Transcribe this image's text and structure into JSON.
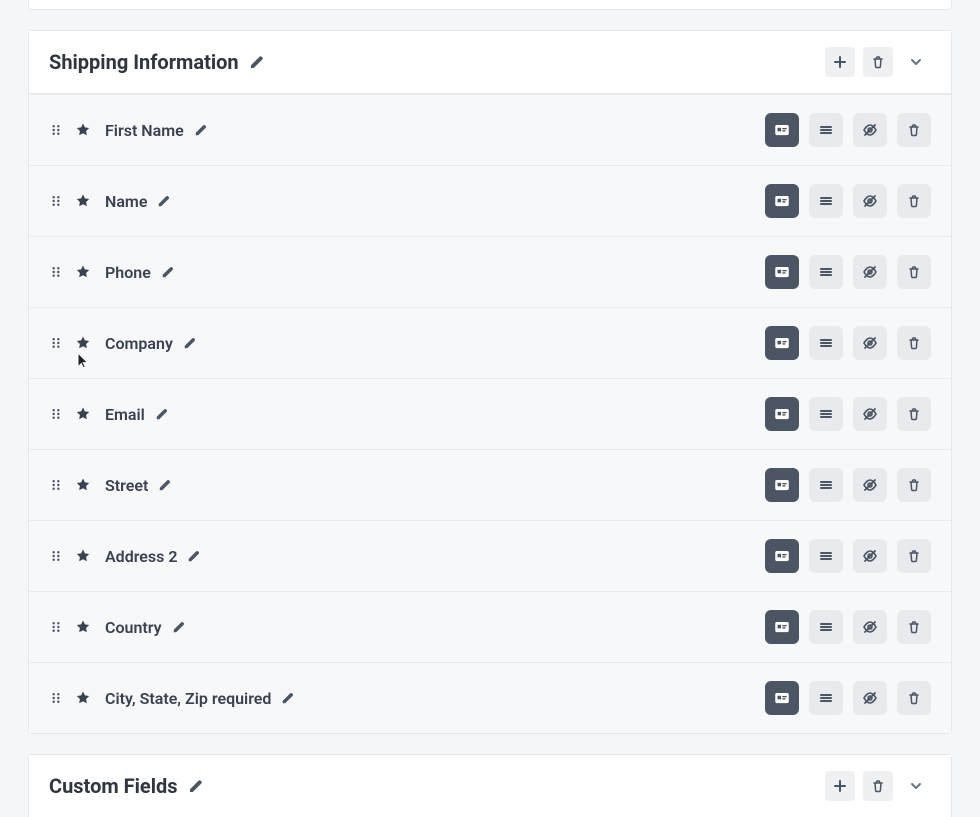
{
  "sections": [
    {
      "title": "Shipping Information",
      "fields": [
        {
          "label": "First Name"
        },
        {
          "label": "Name"
        },
        {
          "label": "Phone"
        },
        {
          "label": "Company"
        },
        {
          "label": "Email"
        },
        {
          "label": "Street"
        },
        {
          "label": "Address 2"
        },
        {
          "label": "Country"
        },
        {
          "label": "City, State, Zip required"
        }
      ]
    },
    {
      "title": "Custom Fields",
      "fields": []
    }
  ],
  "colors": {
    "page_bg": "#f4f6f8",
    "panel_bg": "#ffffff",
    "row_bg": "#f7f8fa",
    "border": "#e5e8eb",
    "text": "#2f3640",
    "icon": "#4b5563",
    "action_bg": "#e8eaed",
    "action_primary_bg": "#4b5563"
  }
}
